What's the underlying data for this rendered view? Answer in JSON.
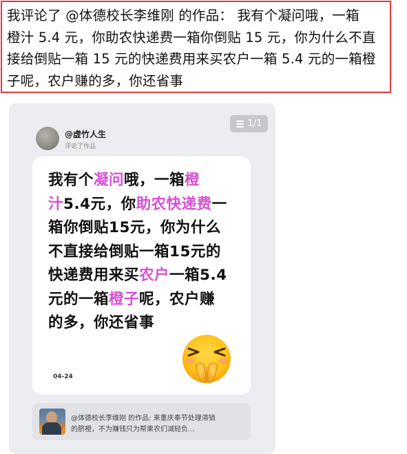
{
  "caption": {
    "lines": [
      "我评论了 @体德校长李维刚 的作品：  我有个凝问哦，一箱",
      "橙汁 5.4 元，你助农快递费一箱你倒贴 15 元，你为什么不直",
      "接给倒贴一箱 15 元的快递费用来买农户一箱 5.4 元的一箱橙",
      "子呢，农户赚的多，你还省事"
    ]
  },
  "card": {
    "page_indicator": "1/1",
    "user": {
      "name": "@虚竹人生",
      "subtitle": "评论了作品"
    },
    "comment_segments": [
      [
        {
          "t": "我有个",
          "h": false
        },
        {
          "t": "凝问",
          "h": true
        },
        {
          "t": "哦，一箱",
          "h": false
        },
        {
          "t": "橙",
          "h": true
        }
      ],
      [
        {
          "t": "汁",
          "h": true
        },
        {
          "t": "5.4元，你",
          "h": false
        },
        {
          "t": "助农快递费",
          "h": true
        },
        {
          "t": "一",
          "h": false
        }
      ],
      [
        {
          "t": "箱你倒贴15元，你为什么",
          "h": false
        }
      ],
      [
        {
          "t": "不直接给倒贴一箱15元的",
          "h": false
        }
      ],
      [
        {
          "t": "快递费用来买",
          "h": false
        },
        {
          "t": "农户",
          "h": true
        },
        {
          "t": "一箱5.4",
          "h": false
        }
      ],
      [
        {
          "t": "元的一箱",
          "h": false
        },
        {
          "t": "橙子",
          "h": true
        },
        {
          "t": "呢，农户赚",
          "h": false
        }
      ],
      [
        {
          "t": "的多，你还省事",
          "h": false
        }
      ]
    ],
    "emoji": "pleading-hands-emoji",
    "date": "04-24",
    "reference": {
      "line1": "@体德校长李维刚 的作品: 来重庆奉节处理滞销",
      "line2": "的脐橙，不为赚钱只为帮果农们减轻负..."
    }
  },
  "colors": {
    "caption_border": "#e0383e",
    "highlight": "#d84fd6",
    "card_background": "#ecedf0"
  }
}
